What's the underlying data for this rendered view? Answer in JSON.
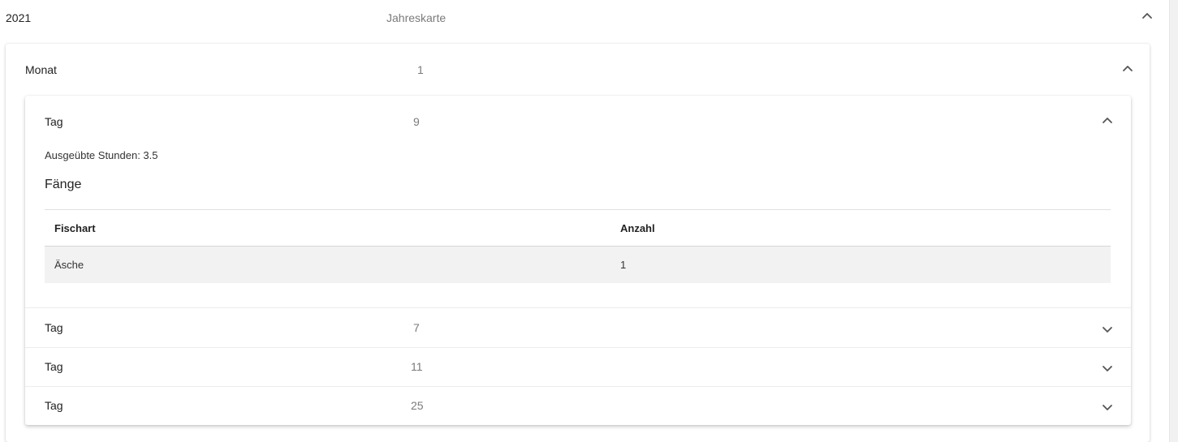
{
  "year": {
    "label": "2021",
    "type": "Jahreskarte",
    "expanded": true
  },
  "month": {
    "label": "Monat",
    "value": "1",
    "expanded": true
  },
  "days": [
    {
      "label": "Tag",
      "value": "9",
      "expanded": true,
      "hours_text": "Ausgeübte Stunden: 3.5",
      "catches_title": "Fänge",
      "table": {
        "headers": [
          "Fischart",
          "Anzahl"
        ],
        "rows": [
          [
            "Äsche",
            "1"
          ]
        ]
      }
    },
    {
      "label": "Tag",
      "value": "7",
      "expanded": false
    },
    {
      "label": "Tag",
      "value": "11",
      "expanded": false
    },
    {
      "label": "Tag",
      "value": "25",
      "expanded": false
    }
  ],
  "icons": {
    "expanded": "chevron-up-icon",
    "collapsed": "chevron-down-icon"
  }
}
